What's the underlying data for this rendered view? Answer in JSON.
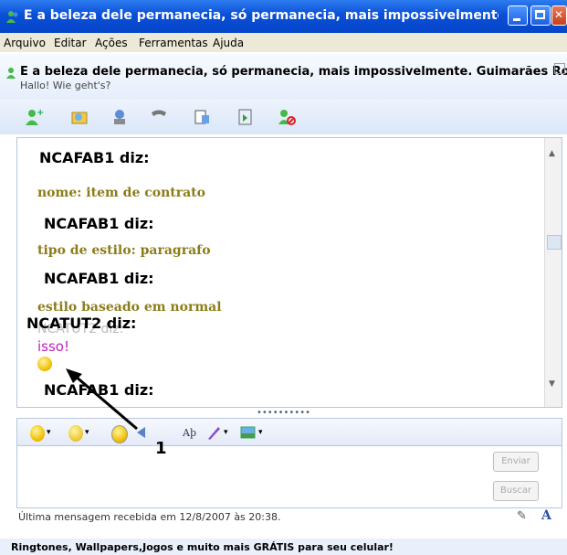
{
  "window": {
    "title": "E a beleza dele permanecia, só permanecia, mais impossivelmente. Guimarã..."
  },
  "menu": {
    "items": [
      "Arquivo",
      "Editar",
      "Ações",
      "Ferramentas",
      "Ajuda"
    ]
  },
  "contact": {
    "name": "E a beleza dele permanecia, só permanecia, mais impossivelmente. Guimarães Rosa",
    "status": "Hallo! Wie geht's?"
  },
  "toolbar": {
    "icons": [
      "invite-contact-icon",
      "send-files-icon",
      "video-call-icon",
      "call-icon",
      "activities-icon",
      "games-icon",
      "block-icon"
    ]
  },
  "chat": {
    "messages": [
      {
        "sender": "NCAFAB1 diz:",
        "text": "nome: item de contrato"
      },
      {
        "sender": "NCAFAB1 diz:",
        "text": "tipo de estilo: paragrafo"
      },
      {
        "sender": "NCAFAB1 diz:",
        "text": "estilo baseado em normal"
      },
      {
        "sender": "NCATUT2 diz:",
        "text": "isso!"
      },
      {
        "sender": "NCAFAB1 diz:",
        "text": ""
      }
    ],
    "overlap_text": "NCATUT2 diz:"
  },
  "compose": {
    "send_label": "Enviar",
    "search_label": "Buscar"
  },
  "annotation": {
    "label": "1"
  },
  "status": {
    "last_message": "Última mensagem recebida em 12/8/2007 às 20:38."
  },
  "ad": {
    "text": "Ringtones, Wallpapers,Jogos e muito mais GRÁTIS para seu celular!"
  },
  "colors": {
    "titlebar": "#0a4fd6",
    "message_text": "#8b7d1a",
    "isso_text": "#c020c0"
  }
}
